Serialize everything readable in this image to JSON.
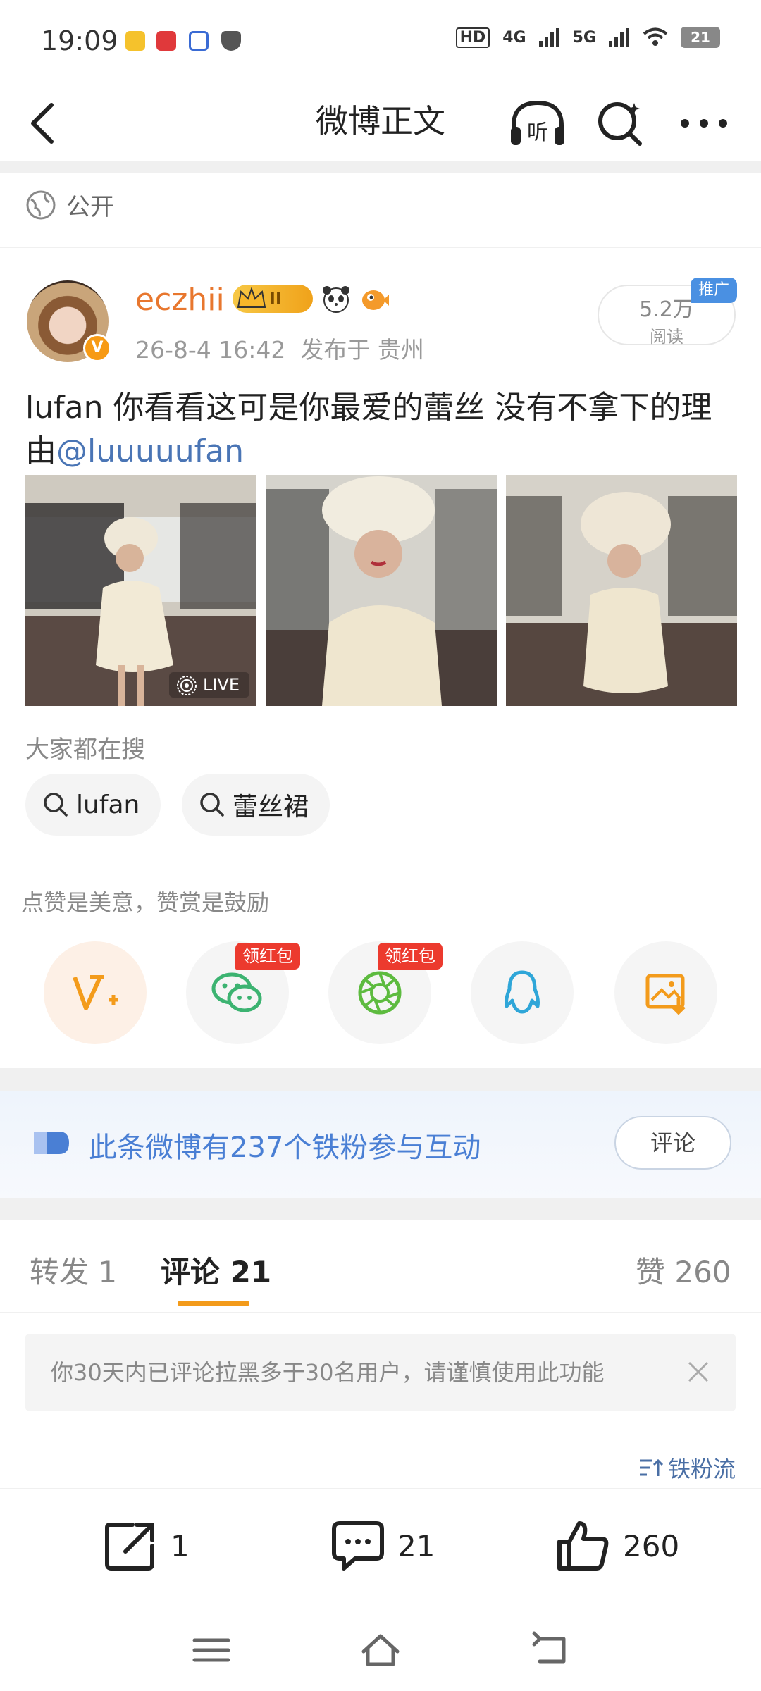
{
  "status_bar": {
    "time": "19:09",
    "network": "4G",
    "network2": "5G",
    "battery": "21",
    "hd": "HD"
  },
  "nav": {
    "title": "微博正文",
    "listen_icon_label": "听"
  },
  "post": {
    "visibility": "公开",
    "author": "eczhii",
    "badge_level": "II",
    "meta": "26-8-4 16:42  发布于 贵州",
    "reads": "5.2万",
    "reads_label": "阅读",
    "promo": "推广",
    "text": "lufan 你看看这可是你最爱的蕾丝 没有不拿下的理由",
    "mention": "@luuuuufan",
    "live_label": "LIVE"
  },
  "search": {
    "title": "大家都在搜",
    "chips": [
      "lufan",
      "蕾丝裙"
    ]
  },
  "actions": {
    "encourage": "点赞是美意，赞赏是鼓励",
    "red_packet_1": "领红包",
    "red_packet_2": "领红包"
  },
  "fans_banner": {
    "text": "此条微博有237个铁粉参与互动",
    "button": "评论"
  },
  "tabs": {
    "repost": "转发 1",
    "comment": "评论 21",
    "likes": "赞 260"
  },
  "warning": {
    "text": "你30天内已评论拉黑多于30名用户，请谨慎使用此功能"
  },
  "sort": {
    "label": "铁粉流"
  },
  "bottom_bar": {
    "repost_count": "1",
    "comment_count": "21",
    "like_count": "260"
  },
  "colors": {
    "accent_orange": "#f39b1b",
    "username": "#e8772e",
    "link_blue": "#4a75b5",
    "fans_blue": "#4a7fd4"
  }
}
